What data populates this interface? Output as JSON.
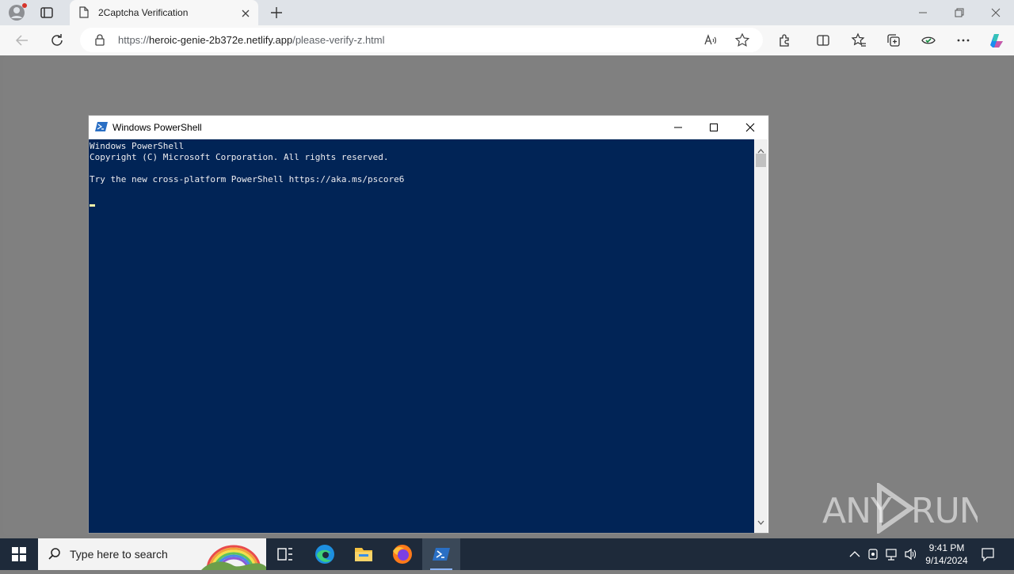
{
  "browser": {
    "tab": {
      "title": "2Captcha Verification"
    },
    "address": {
      "scheme": "https://",
      "host": "heroic-genie-2b372e.netlify.app",
      "path": "/please-verify-z.html"
    }
  },
  "powershell": {
    "title": "Windows PowerShell",
    "lines": [
      "Windows PowerShell",
      "Copyright (C) Microsoft Corporation. All rights reserved.",
      "",
      "Try the new cross-platform PowerShell https://aka.ms/pscore6",
      ""
    ],
    "colors": {
      "background": "#012456",
      "text": "#eeedf0"
    }
  },
  "watermark": {
    "text": "ANY RUN"
  },
  "taskbar": {
    "search_placeholder": "Type here to search",
    "time": "9:41 PM",
    "date": "9/14/2024",
    "apps": [
      "task-view",
      "edge",
      "file-explorer",
      "firefox",
      "powershell"
    ]
  }
}
